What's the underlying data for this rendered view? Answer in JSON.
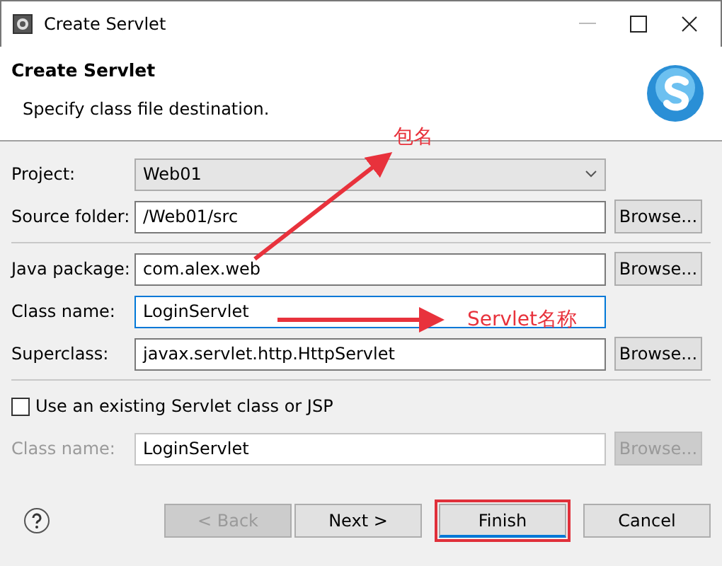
{
  "window": {
    "title": "Create Servlet"
  },
  "header": {
    "title": "Create Servlet",
    "subtitle": "Specify class file destination."
  },
  "groups": [
    {
      "fields": [
        {
          "label": "Project:",
          "kind": "combo",
          "value": "Web01",
          "focused": false,
          "disabled": false
        },
        {
          "label": "Source folder:",
          "kind": "text",
          "value": "/Web01/src",
          "browse": "Browse...",
          "focused": false,
          "disabled": false
        }
      ]
    },
    {
      "fields": [
        {
          "label": "Java package:",
          "kind": "text",
          "value": "com.alex.web",
          "browse": "Browse...",
          "focused": false,
          "disabled": false
        },
        {
          "label": "Class name:",
          "kind": "text",
          "value": "LoginServlet",
          "focused": true,
          "disabled": false
        },
        {
          "label": "Superclass:",
          "kind": "text",
          "value": "javax.servlet.http.HttpServlet",
          "browse": "Browse...",
          "focused": false,
          "disabled": false
        }
      ]
    },
    {
      "checkbox": {
        "label": "Use an existing Servlet class or JSP",
        "checked": false
      },
      "fields": [
        {
          "label": "Class name:",
          "kind": "text",
          "value": "LoginServlet",
          "browse": "Browse...",
          "focused": false,
          "disabled": true
        }
      ]
    }
  ],
  "buttons": [
    {
      "label": "< Back",
      "disabled": true,
      "highlighted": false
    },
    {
      "label": "Next >",
      "disabled": false,
      "highlighted": false
    },
    {
      "label": "Finish",
      "disabled": false,
      "highlighted": true
    },
    {
      "label": "Cancel",
      "disabled": false,
      "highlighted": false
    }
  ],
  "annotations": [
    "包名",
    "Servlet名称"
  ]
}
